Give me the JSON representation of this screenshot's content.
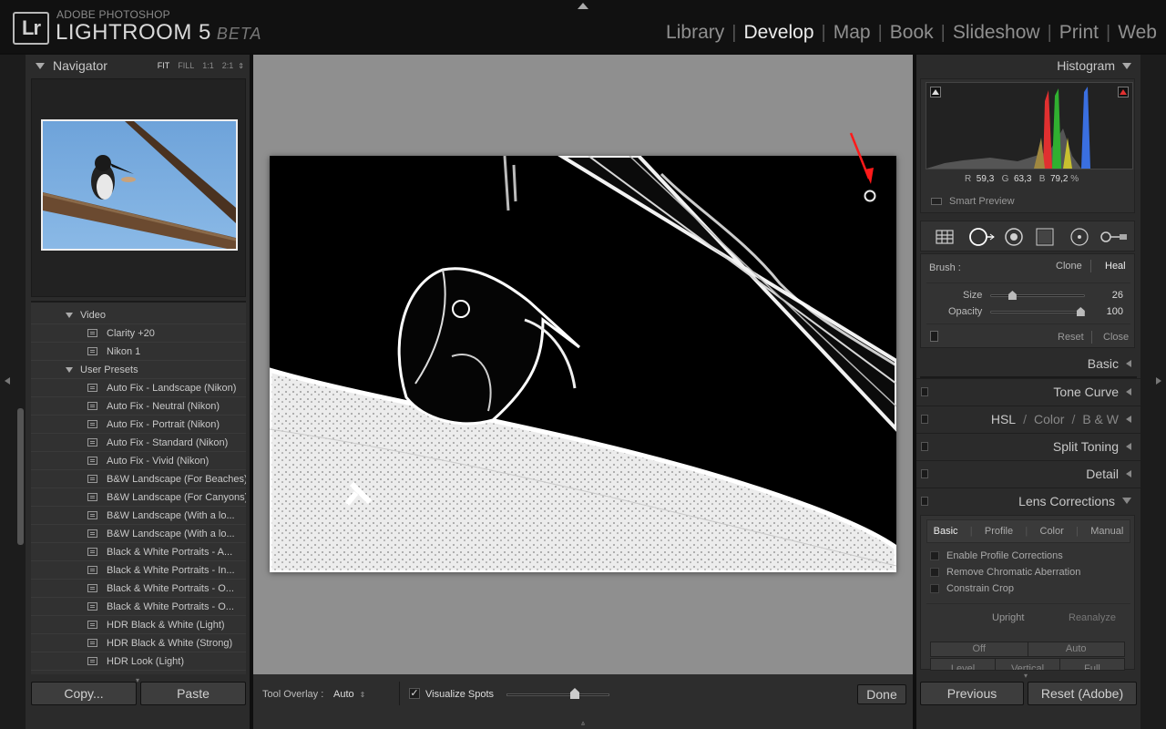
{
  "app": {
    "logo": "Lr",
    "brand_top": "ADOBE PHOTOSHOP",
    "brand_name": "LIGHTROOM 5",
    "brand_tag": "BETA"
  },
  "modules": [
    {
      "label": "Library",
      "active": false
    },
    {
      "label": "Develop",
      "active": true
    },
    {
      "label": "Map",
      "active": false
    },
    {
      "label": "Book",
      "active": false
    },
    {
      "label": "Slideshow",
      "active": false
    },
    {
      "label": "Print",
      "active": false
    },
    {
      "label": "Web",
      "active": false
    }
  ],
  "navigator": {
    "title": "Navigator",
    "zoom": [
      "FIT",
      "FILL",
      "1:1",
      "2:1"
    ],
    "active_zoom": "FIT"
  },
  "presets": {
    "rows": [
      {
        "type": "folder",
        "label": "Video"
      },
      {
        "type": "item",
        "label": "Clarity +20"
      },
      {
        "type": "item",
        "label": "Nikon 1"
      },
      {
        "type": "folder",
        "label": "User Presets"
      },
      {
        "type": "item",
        "label": "Auto Fix - Landscape (Nikon)"
      },
      {
        "type": "item",
        "label": "Auto Fix - Neutral (Nikon)"
      },
      {
        "type": "item",
        "label": "Auto Fix - Portrait (Nikon)"
      },
      {
        "type": "item",
        "label": "Auto Fix - Standard (Nikon)"
      },
      {
        "type": "item",
        "label": "Auto Fix - Vivid (Nikon)"
      },
      {
        "type": "item",
        "label": "B&W Landscape (For Beaches)"
      },
      {
        "type": "item",
        "label": "B&W Landscape (For Canyons)"
      },
      {
        "type": "item",
        "label": "B&W Landscape (With a lo..."
      },
      {
        "type": "item",
        "label": "B&W Landscape (With a lo..."
      },
      {
        "type": "item",
        "label": "Black & White Portraits - A..."
      },
      {
        "type": "item",
        "label": "Black & White Portraits - In..."
      },
      {
        "type": "item",
        "label": "Black & White Portraits - O..."
      },
      {
        "type": "item",
        "label": "Black & White Portraits - O..."
      },
      {
        "type": "item",
        "label": "HDR Black & White (Light)"
      },
      {
        "type": "item",
        "label": "HDR Black & White (Strong)"
      },
      {
        "type": "item",
        "label": "HDR Look (Light)"
      }
    ]
  },
  "left_buttons": {
    "copy": "Copy...",
    "paste": "Paste"
  },
  "toolbar": {
    "overlay_label": "Tool Overlay :",
    "overlay_value": "Auto",
    "visualize_label": "Visualize Spots",
    "visualize_checked": true,
    "done": "Done"
  },
  "histogram": {
    "title": "Histogram",
    "r_label": "R",
    "r_value": "59,3",
    "g_label": "G",
    "g_value": "63,3",
    "b_label": "B",
    "b_value": "79,2",
    "unit": "%",
    "smart_preview": "Smart Preview"
  },
  "spot_tool": {
    "brush_label": "Brush :",
    "clone": "Clone",
    "heal": "Heal",
    "size_label": "Size",
    "size_value": "26",
    "size_level": 0.23,
    "opacity_label": "Opacity",
    "opacity_value": "100",
    "opacity_level": 0.95,
    "reset": "Reset",
    "close": "Close"
  },
  "sections": {
    "basic": "Basic",
    "tone_curve": "Tone Curve",
    "hsl": "HSL",
    "color": "Color",
    "bw": "B & W",
    "split_toning": "Split Toning",
    "detail": "Detail",
    "lens": "Lens Corrections"
  },
  "lens": {
    "tabs": [
      "Basic",
      "Profile",
      "Color",
      "Manual"
    ],
    "active_tab": "Basic",
    "checks": [
      "Enable Profile Corrections",
      "Remove Chromatic Aberration",
      "Constrain Crop"
    ],
    "upright": "Upright",
    "reanalyze": "Reanalyze",
    "off": "Off",
    "auto": "Auto",
    "level": "Level",
    "vertical": "Vertical",
    "full": "Full"
  },
  "right_buttons": {
    "previous": "Previous",
    "reset": "Reset (Adobe)"
  },
  "colors": {
    "accent_red": "#ff1a1a",
    "hist_red": "#e03030",
    "hist_green": "#30b030",
    "hist_blue": "#3a6fe0"
  }
}
